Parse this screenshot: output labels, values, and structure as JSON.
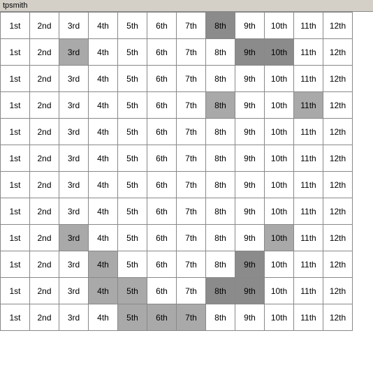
{
  "title": "tpsmith",
  "cols": [
    "1st",
    "2nd",
    "3rd",
    "4th",
    "5th",
    "6th",
    "7th",
    "8th",
    "9th",
    "10th",
    "11th",
    "12th"
  ],
  "rows": [
    {
      "cells": [
        {
          "text": "1st",
          "style": ""
        },
        {
          "text": "2nd",
          "style": ""
        },
        {
          "text": "3rd",
          "style": ""
        },
        {
          "text": "4th",
          "style": ""
        },
        {
          "text": "5th",
          "style": ""
        },
        {
          "text": "6th",
          "style": ""
        },
        {
          "text": "7th",
          "style": ""
        },
        {
          "text": "8th",
          "style": "highlight-dark"
        },
        {
          "text": "9th",
          "style": ""
        },
        {
          "text": "10th",
          "style": ""
        },
        {
          "text": "11th",
          "style": ""
        },
        {
          "text": "12th",
          "style": ""
        }
      ]
    },
    {
      "cells": [
        {
          "text": "1st",
          "style": ""
        },
        {
          "text": "2nd",
          "style": ""
        },
        {
          "text": "3rd",
          "style": "highlight-medium"
        },
        {
          "text": "4th",
          "style": ""
        },
        {
          "text": "5th",
          "style": ""
        },
        {
          "text": "6th",
          "style": ""
        },
        {
          "text": "7th",
          "style": ""
        },
        {
          "text": "8th",
          "style": ""
        },
        {
          "text": "9th",
          "style": "highlight-dark"
        },
        {
          "text": "10th",
          "style": "highlight-dark"
        },
        {
          "text": "11th",
          "style": ""
        },
        {
          "text": "12th",
          "style": ""
        }
      ]
    },
    {
      "cells": [
        {
          "text": "1st",
          "style": ""
        },
        {
          "text": "2nd",
          "style": ""
        },
        {
          "text": "3rd",
          "style": ""
        },
        {
          "text": "4th",
          "style": ""
        },
        {
          "text": "5th",
          "style": ""
        },
        {
          "text": "6th",
          "style": ""
        },
        {
          "text": "7th",
          "style": ""
        },
        {
          "text": "8th",
          "style": ""
        },
        {
          "text": "9th",
          "style": ""
        },
        {
          "text": "10th",
          "style": ""
        },
        {
          "text": "11th",
          "style": ""
        },
        {
          "text": "12th",
          "style": ""
        }
      ]
    },
    {
      "cells": [
        {
          "text": "1st",
          "style": ""
        },
        {
          "text": "2nd",
          "style": ""
        },
        {
          "text": "3rd",
          "style": ""
        },
        {
          "text": "4th",
          "style": ""
        },
        {
          "text": "5th",
          "style": ""
        },
        {
          "text": "6th",
          "style": ""
        },
        {
          "text": "7th",
          "style": ""
        },
        {
          "text": "8th",
          "style": "highlight-medium"
        },
        {
          "text": "9th",
          "style": ""
        },
        {
          "text": "10th",
          "style": ""
        },
        {
          "text": "11th",
          "style": "highlight-medium"
        },
        {
          "text": "12th",
          "style": ""
        }
      ]
    },
    {
      "cells": [
        {
          "text": "1st",
          "style": ""
        },
        {
          "text": "2nd",
          "style": ""
        },
        {
          "text": "3rd",
          "style": ""
        },
        {
          "text": "4th",
          "style": ""
        },
        {
          "text": "5th",
          "style": ""
        },
        {
          "text": "6th",
          "style": ""
        },
        {
          "text": "7th",
          "style": ""
        },
        {
          "text": "8th",
          "style": ""
        },
        {
          "text": "9th",
          "style": ""
        },
        {
          "text": "10th",
          "style": ""
        },
        {
          "text": "11th",
          "style": ""
        },
        {
          "text": "12th",
          "style": ""
        }
      ]
    },
    {
      "cells": [
        {
          "text": "1st",
          "style": ""
        },
        {
          "text": "2nd",
          "style": ""
        },
        {
          "text": "3rd",
          "style": ""
        },
        {
          "text": "4th",
          "style": ""
        },
        {
          "text": "5th",
          "style": ""
        },
        {
          "text": "6th",
          "style": ""
        },
        {
          "text": "7th",
          "style": ""
        },
        {
          "text": "8th",
          "style": ""
        },
        {
          "text": "9th",
          "style": ""
        },
        {
          "text": "10th",
          "style": ""
        },
        {
          "text": "11th",
          "style": ""
        },
        {
          "text": "12th",
          "style": ""
        }
      ]
    },
    {
      "cells": [
        {
          "text": "1st",
          "style": ""
        },
        {
          "text": "2nd",
          "style": ""
        },
        {
          "text": "3rd",
          "style": ""
        },
        {
          "text": "4th",
          "style": ""
        },
        {
          "text": "5th",
          "style": ""
        },
        {
          "text": "6th",
          "style": ""
        },
        {
          "text": "7th",
          "style": ""
        },
        {
          "text": "8th",
          "style": ""
        },
        {
          "text": "9th",
          "style": ""
        },
        {
          "text": "10th",
          "style": ""
        },
        {
          "text": "11th",
          "style": ""
        },
        {
          "text": "12th",
          "style": ""
        }
      ]
    },
    {
      "cells": [
        {
          "text": "1st",
          "style": ""
        },
        {
          "text": "2nd",
          "style": ""
        },
        {
          "text": "3rd",
          "style": ""
        },
        {
          "text": "4th",
          "style": ""
        },
        {
          "text": "5th",
          "style": ""
        },
        {
          "text": "6th",
          "style": ""
        },
        {
          "text": "7th",
          "style": ""
        },
        {
          "text": "8th",
          "style": ""
        },
        {
          "text": "9th",
          "style": ""
        },
        {
          "text": "10th",
          "style": ""
        },
        {
          "text": "11th",
          "style": ""
        },
        {
          "text": "12th",
          "style": ""
        }
      ]
    },
    {
      "cells": [
        {
          "text": "1st",
          "style": ""
        },
        {
          "text": "2nd",
          "style": ""
        },
        {
          "text": "3rd",
          "style": "highlight-medium"
        },
        {
          "text": "4th",
          "style": ""
        },
        {
          "text": "5th",
          "style": ""
        },
        {
          "text": "6th",
          "style": ""
        },
        {
          "text": "7th",
          "style": ""
        },
        {
          "text": "8th",
          "style": ""
        },
        {
          "text": "9th",
          "style": ""
        },
        {
          "text": "10th",
          "style": "highlight-medium"
        },
        {
          "text": "11th",
          "style": ""
        },
        {
          "text": "12th",
          "style": ""
        }
      ]
    },
    {
      "cells": [
        {
          "text": "1st",
          "style": ""
        },
        {
          "text": "2nd",
          "style": ""
        },
        {
          "text": "3rd",
          "style": ""
        },
        {
          "text": "4th",
          "style": "highlight-medium"
        },
        {
          "text": "5th",
          "style": ""
        },
        {
          "text": "6th",
          "style": ""
        },
        {
          "text": "7th",
          "style": ""
        },
        {
          "text": "8th",
          "style": ""
        },
        {
          "text": "9th",
          "style": "highlight-dark"
        },
        {
          "text": "10th",
          "style": ""
        },
        {
          "text": "11th",
          "style": ""
        },
        {
          "text": "12th",
          "style": ""
        }
      ]
    },
    {
      "cells": [
        {
          "text": "1st",
          "style": ""
        },
        {
          "text": "2nd",
          "style": ""
        },
        {
          "text": "3rd",
          "style": ""
        },
        {
          "text": "4th",
          "style": "highlight-medium"
        },
        {
          "text": "5th",
          "style": "highlight-medium"
        },
        {
          "text": "6th",
          "style": ""
        },
        {
          "text": "7th",
          "style": ""
        },
        {
          "text": "8th",
          "style": "highlight-dark"
        },
        {
          "text": "9th",
          "style": "highlight-dark"
        },
        {
          "text": "10th",
          "style": ""
        },
        {
          "text": "11th",
          "style": ""
        },
        {
          "text": "12th",
          "style": ""
        }
      ]
    },
    {
      "cells": [
        {
          "text": "1st",
          "style": ""
        },
        {
          "text": "2nd",
          "style": ""
        },
        {
          "text": "3rd",
          "style": ""
        },
        {
          "text": "4th",
          "style": ""
        },
        {
          "text": "5th",
          "style": "highlight-medium"
        },
        {
          "text": "6th",
          "style": "highlight-medium"
        },
        {
          "text": "7th",
          "style": "highlight-medium"
        },
        {
          "text": "8th",
          "style": ""
        },
        {
          "text": "9th",
          "style": ""
        },
        {
          "text": "10th",
          "style": ""
        },
        {
          "text": "11th",
          "style": ""
        },
        {
          "text": "12th",
          "style": ""
        }
      ]
    }
  ]
}
